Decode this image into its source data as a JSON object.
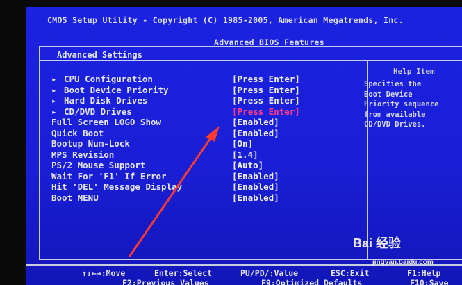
{
  "header": {
    "title": "CMOS Setup Utility - Copyright (C) 1985-2005, American Megatrends, Inc.",
    "subtitle": "Advanced BIOS Features"
  },
  "section_title": "Advanced Settings",
  "help": {
    "title": "Help Item",
    "text": "Specifies the\nBoot Device\nPriority sequence\nfrom available\nCD/DVD Drives."
  },
  "settings": [
    {
      "label": "CPU Configuration",
      "value": "[Press Enter]",
      "submenu": true
    },
    {
      "label": "Boot Device Priority",
      "value": "[Press Enter]",
      "submenu": true
    },
    {
      "label": "Hard Disk Drives",
      "value": "[Press Enter]",
      "submenu": true
    },
    {
      "label": "CD/DVD Drives",
      "value": "[Press Enter]",
      "submenu": true,
      "selected": true
    },
    {
      "label": "Full Screen LOGO Show",
      "value": "[Enabled]"
    },
    {
      "label": "Quick Boot",
      "value": "[Enabled]"
    },
    {
      "label": "Bootup Num-Lock",
      "value": "[On]"
    },
    {
      "label": "MPS Revision",
      "value": "[1.4]"
    },
    {
      "label": "PS/2 Mouse Support",
      "value": "[Auto]"
    },
    {
      "label": "Wait For 'F1' If Error",
      "value": "[Enabled]"
    },
    {
      "label": "Hit 'DEL' Message Display",
      "value": "[Enabled]"
    },
    {
      "label": "Boot MENU",
      "value": "[Enabled]"
    }
  ],
  "footer": {
    "move": "↑↓←→:Move",
    "select": "Enter:Select",
    "value": "PU/PD/:Value",
    "exit": "ESC:Exit",
    "help": "F1:Help",
    "previous": "F2:Previous Values",
    "optimized": "F9:Optimized Defaults",
    "save": "F10:Save"
  },
  "watermark": {
    "brand": "Bai 经验",
    "url": "jingyan.baidu.com"
  },
  "colors": {
    "bios_blue": "#1a1fd6",
    "highlight": "#ff3d8a",
    "annotation_arrow": "#ff3b30"
  }
}
